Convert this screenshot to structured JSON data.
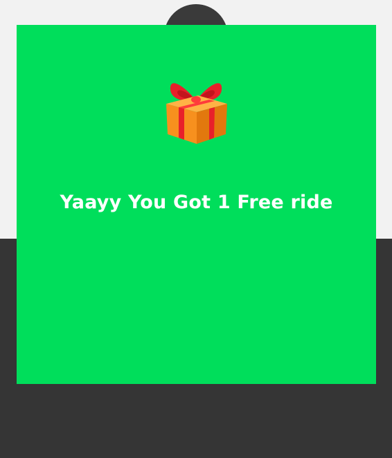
{
  "reward": {
    "message": "Yaayy You Got 1 Free ride",
    "icon": "gift-icon"
  },
  "colors": {
    "card_background": "#00de5b",
    "page_background": "#f2f2f2",
    "bottom_band": "#353535",
    "message_text": "#ffffff",
    "gift_box": "#f7901e",
    "gift_ribbon": "#e8202a"
  }
}
